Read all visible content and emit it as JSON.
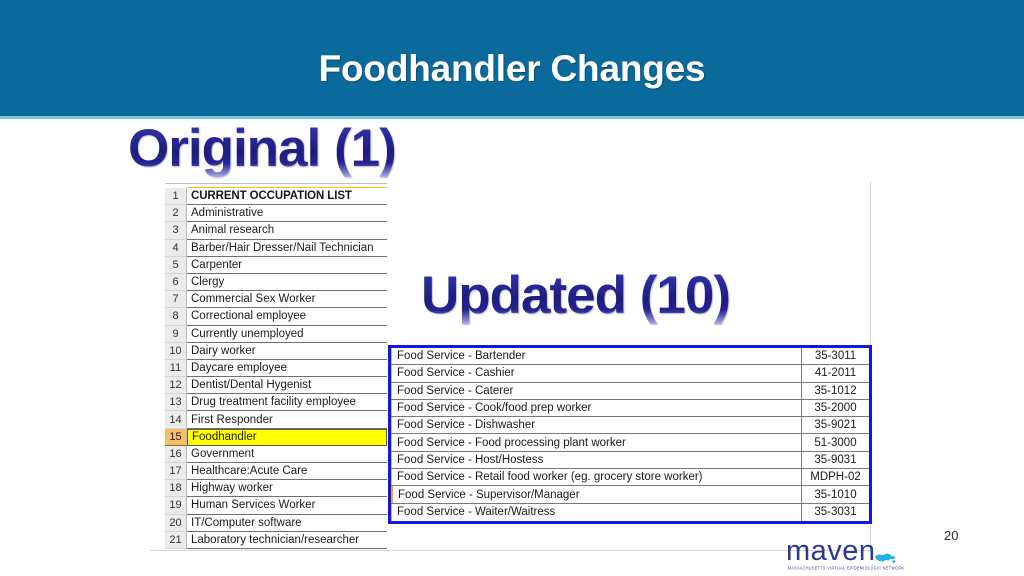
{
  "slide": {
    "title": "Foodhandler Changes",
    "page_number": "20",
    "band_color": "#0b6a9c",
    "band_underline_color": "#7fc4dd",
    "heading_gradient_top": "#3b3bb5",
    "heading_gradient_bottom": "#c9c9ea"
  },
  "headings": {
    "original": "Original (1)",
    "updated": "Updated (10)"
  },
  "original_table": {
    "highlight_color": "#ffff00",
    "rows": [
      {
        "num": "1",
        "label": "CURRENT OCCUPATION LIST",
        "header": true,
        "highlight": false
      },
      {
        "num": "2",
        "label": "Administrative",
        "header": false,
        "highlight": false
      },
      {
        "num": "3",
        "label": "Animal research",
        "header": false,
        "highlight": false
      },
      {
        "num": "4",
        "label": "Barber/Hair Dresser/Nail Technician",
        "header": false,
        "highlight": false
      },
      {
        "num": "5",
        "label": "Carpenter",
        "header": false,
        "highlight": false
      },
      {
        "num": "6",
        "label": "Clergy",
        "header": false,
        "highlight": false
      },
      {
        "num": "7",
        "label": "Commercial Sex Worker",
        "header": false,
        "highlight": false
      },
      {
        "num": "8",
        "label": "Correctional employee",
        "header": false,
        "highlight": false
      },
      {
        "num": "9",
        "label": "Currently unemployed",
        "header": false,
        "highlight": false
      },
      {
        "num": "10",
        "label": "Dairy worker",
        "header": false,
        "highlight": false
      },
      {
        "num": "11",
        "label": "Daycare employee",
        "header": false,
        "highlight": false
      },
      {
        "num": "12",
        "label": "Dentist/Dental Hygenist",
        "header": false,
        "highlight": false
      },
      {
        "num": "13",
        "label": "Drug treatment facility employee",
        "header": false,
        "highlight": false
      },
      {
        "num": "14",
        "label": "First Responder",
        "header": false,
        "highlight": false
      },
      {
        "num": "15",
        "label": "Foodhandler",
        "header": false,
        "highlight": true
      },
      {
        "num": "16",
        "label": "Government",
        "header": false,
        "highlight": false
      },
      {
        "num": "17",
        "label": "Healthcare:Acute Care",
        "header": false,
        "highlight": false
      },
      {
        "num": "18",
        "label": "Highway worker",
        "header": false,
        "highlight": false
      },
      {
        "num": "19",
        "label": "Human Services Worker",
        "header": false,
        "highlight": false
      },
      {
        "num": "20",
        "label": "IT/Computer software",
        "header": false,
        "highlight": false
      },
      {
        "num": "21",
        "label": "Laboratory technician/researcher",
        "header": false,
        "highlight": false
      }
    ]
  },
  "updated_table": {
    "border_color": "#1414e6",
    "rows": [
      {
        "label": "Food Service - Bartender",
        "code": "35-3011",
        "mark": false
      },
      {
        "label": "Food Service - Cashier",
        "code": "41-2011",
        "mark": false
      },
      {
        "label": "Food Service - Caterer",
        "code": "35-1012",
        "mark": false
      },
      {
        "label": "Food Service - Cook/food prep worker",
        "code": "35-2000",
        "mark": false
      },
      {
        "label": "Food Service - Dishwasher",
        "code": "35-9021",
        "mark": false
      },
      {
        "label": "Food Service - Food processing plant worker",
        "code": "51-3000",
        "mark": false
      },
      {
        "label": "Food Service - Host/Hostess",
        "code": "35-9031",
        "mark": false
      },
      {
        "label": "Food Service - Retail food worker (eg. grocery store worker)",
        "code": "MDPH-02",
        "mark": false
      },
      {
        "label": "Food Service - Supervisor/Manager",
        "code": "35-1010",
        "mark": true
      },
      {
        "label": "Food Service - Waiter/Waitress",
        "code": "35-3031",
        "mark": false
      }
    ]
  },
  "logo": {
    "wordmark": "maven",
    "tagline": "MASSACHUSETTS VIRTUAL EPIDEMIOLOGIC NETWORK",
    "wordmark_color": "#2b3a8f",
    "state_color": "#1fb6e3"
  }
}
